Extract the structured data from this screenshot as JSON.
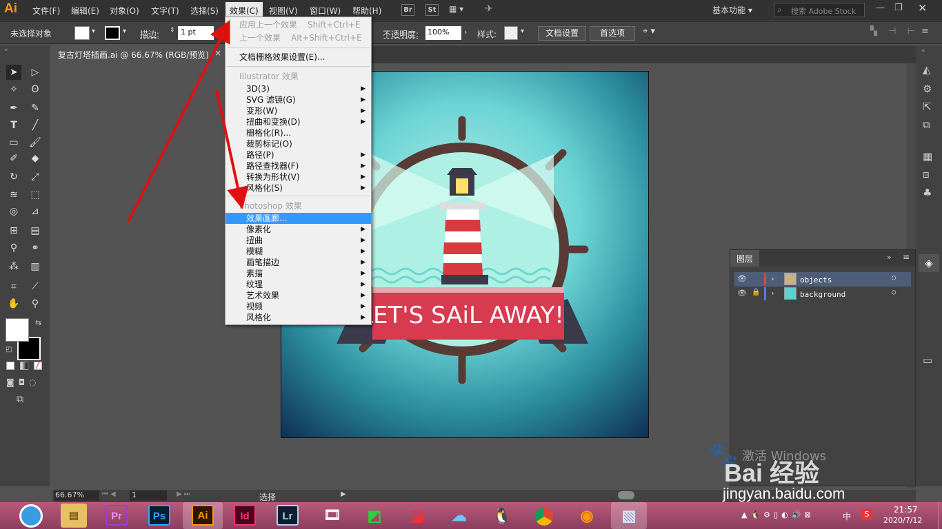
{
  "app": {
    "logo": "Ai"
  },
  "menubar": {
    "items": [
      "文件(F)",
      "编辑(E)",
      "对象(O)",
      "文字(T)",
      "选择(S)",
      "效果(C)",
      "视图(V)",
      "窗口(W)",
      "帮助(H)"
    ],
    "br": "Br",
    "st": "St",
    "workspace": "基本功能",
    "search_placeholder": "搜索 Adobe Stock"
  },
  "control": {
    "no_selection": "未选择对象",
    "stroke_label": "描边:",
    "stroke_value": "1 pt",
    "opacity_label": "不透明度:",
    "opacity_value": "100%",
    "style_label": "样式:",
    "doc_setup": "文档设置",
    "prefs": "首选项"
  },
  "document": {
    "tab_title": "复古灯塔插画.ai @ 66.67% (RGB/预览)",
    "close": "×"
  },
  "artwork": {
    "banner_text": "LET'S SAiL AWAY!"
  },
  "effect_menu": {
    "apply_last": "应用上一个效果",
    "apply_last_sc": "Shift+Ctrl+E",
    "last": "上一个效果",
    "last_sc": "Alt+Shift+Ctrl+E",
    "raster_settings": "文档栅格效果设置(E)...",
    "illustrator_header": "Illustrator 效果",
    "illustrator_items": [
      "3D(3)",
      "SVG 滤镜(G)",
      "变形(W)",
      "扭曲和变换(D)",
      "栅格化(R)...",
      "裁剪标记(O)",
      "路径(P)",
      "路径查找器(F)",
      "转换为形状(V)",
      "风格化(S)"
    ],
    "photoshop_header": "Photoshop 效果",
    "photoshop_items": [
      "效果画廊...",
      "像素化",
      "扭曲",
      "模糊",
      "画笔描边",
      "素描",
      "纹理",
      "艺术效果",
      "视频",
      "风格化"
    ]
  },
  "layers": {
    "title": "图层",
    "rows": [
      {
        "name": "objects",
        "color": "#e0463f",
        "selected": true
      },
      {
        "name": "background",
        "color": "#4f7cff",
        "selected": false
      }
    ]
  },
  "status": {
    "zoom": "66.67%",
    "page": "1",
    "tool": "选择"
  },
  "taskbar": {
    "apps": [
      {
        "label": "Pr",
        "bg": "#2a0a3a",
        "fg": "#e98fff"
      },
      {
        "label": "Ps",
        "bg": "#071d33",
        "fg": "#31a8ff"
      },
      {
        "label": "Ai",
        "bg": "#2e1300",
        "fg": "#ff9a00"
      },
      {
        "label": "Id",
        "bg": "#49021f",
        "fg": "#ff3366"
      },
      {
        "label": "Lr",
        "bg": "#0a1f2e",
        "fg": "#add5ec"
      }
    ],
    "ime": "中",
    "time": "21:57",
    "date": "2020/7/12"
  },
  "watermark": {
    "line1": "激活 Windows",
    "brand": "Bai 经验",
    "url": "jingyan.baidu.com"
  },
  "colors": {
    "highlight": "#3399ff",
    "arrow": "#e01010",
    "panel": "#424242"
  }
}
